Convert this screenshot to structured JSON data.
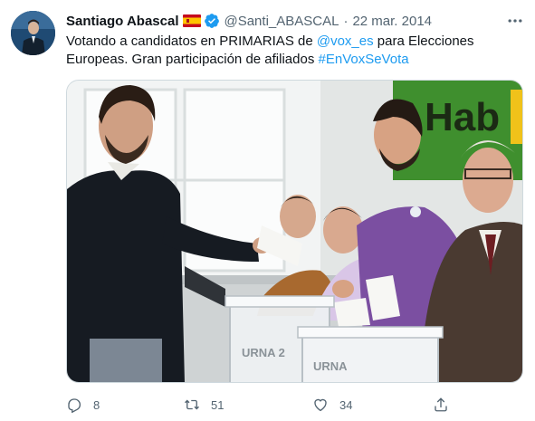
{
  "tweet": {
    "author": {
      "name": "Santiago Abascal",
      "handle": "@Santi_ABASCAL",
      "flag_icon": "spain-flag-icon",
      "verified_icon": "verified-badge-icon",
      "verified_color": "#1d9bf0"
    },
    "separator": "·",
    "date": "22 mar. 2014",
    "text": {
      "part1": "Votando a candidatos en PRIMARIAS de ",
      "mention": "@vox_es",
      "part2": " para Elecciones Europeas. Gran participación de afiliados ",
      "hashtag": "#EnVoxSeVota"
    },
    "photo": {
      "banner_text": "Hab",
      "ballot_box_label_1": "URNA 2",
      "ballot_box_label_2": "URNA"
    },
    "actions": {
      "replies": "8",
      "retweets": "51",
      "likes": "34"
    }
  },
  "colors": {
    "link": "#1d9bf0",
    "secondary_text": "#536471",
    "primary_text": "#0f1419"
  }
}
